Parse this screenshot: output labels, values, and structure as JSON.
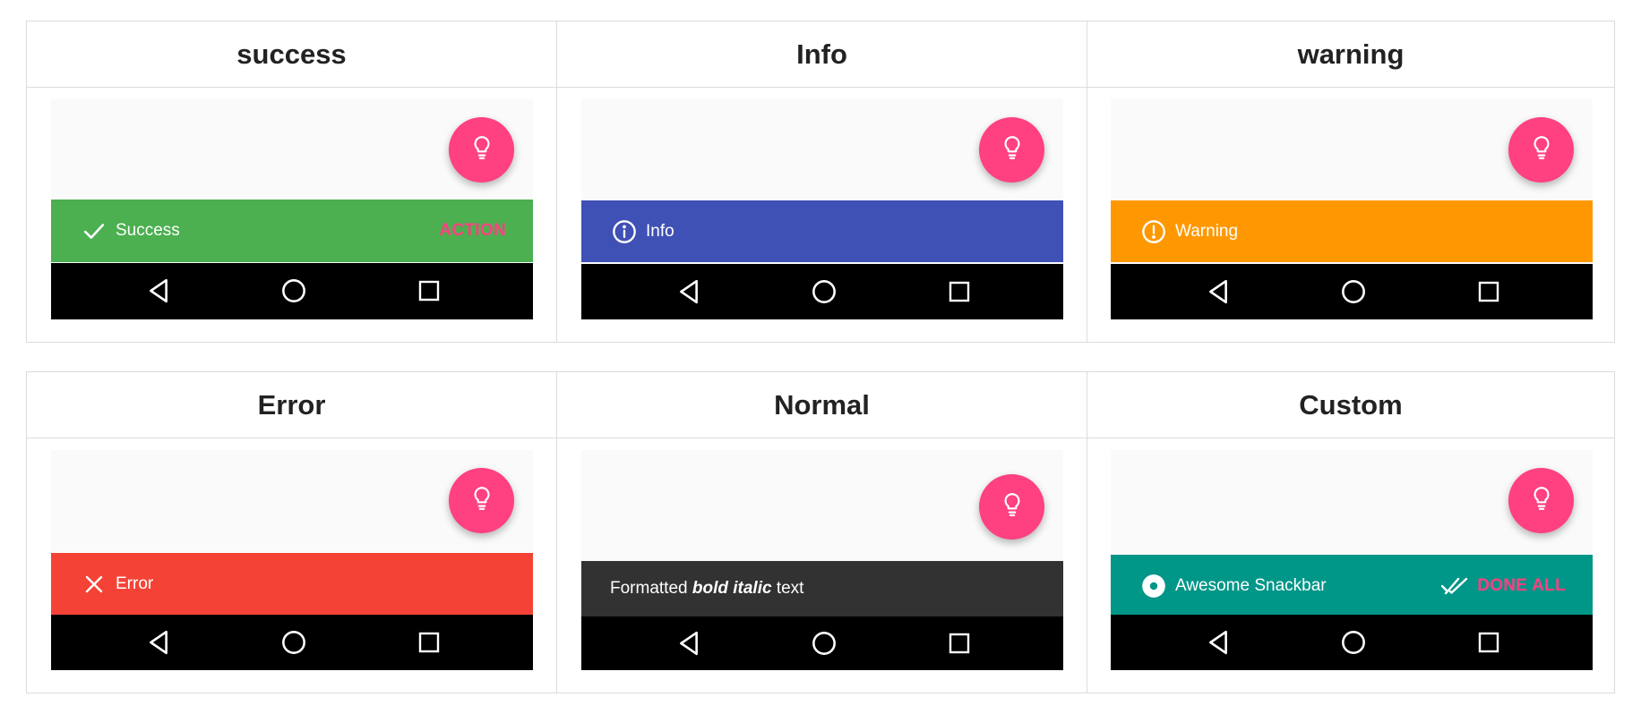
{
  "rows": [
    [
      {
        "header": "success",
        "snack_color": "#4caf50",
        "message": "Success",
        "icon": "check-icon",
        "action": "ACTION"
      },
      {
        "header": "Info",
        "snack_color": "#3f51b5",
        "message": "Info",
        "icon": "info-circle-icon",
        "action": ""
      },
      {
        "header": "warning",
        "snack_color": "#ff9800",
        "message": "Warning",
        "icon": "alert-circle-icon",
        "action": ""
      }
    ],
    [
      {
        "header": "Error",
        "snack_color": "#f44336",
        "message": "Error",
        "icon": "close-icon",
        "action": ""
      },
      {
        "header": "Normal",
        "snack_color": "#323232",
        "message_parts": [
          "Formatted ",
          "bold italic",
          " text"
        ],
        "icon": "",
        "action": ""
      },
      {
        "header": "Custom",
        "snack_color": "#009688",
        "message": "Awesome Snackbar",
        "icon": "radio-dot-icon",
        "action": "DONE ALL",
        "action_icon": "done-all-icon"
      }
    ]
  ],
  "fab_color": "#ff4081",
  "fab_icon": "lightbulb-icon",
  "nav_icons": [
    "back-triangle-icon",
    "home-circle-icon",
    "recents-square-icon"
  ]
}
